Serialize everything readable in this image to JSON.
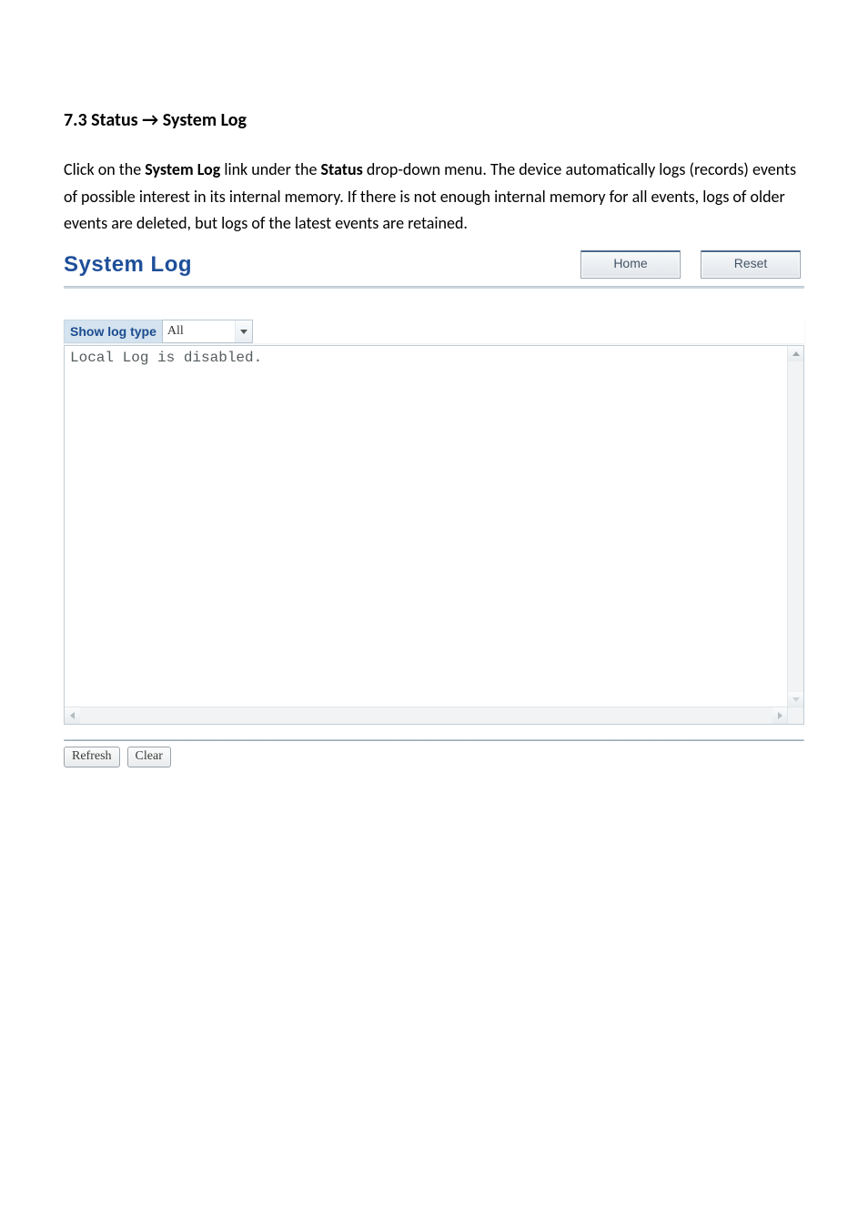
{
  "section": {
    "heading": "7.3 Status → System Log",
    "paragraph_parts": {
      "p1": "Click on the ",
      "b1": "System Log",
      "p2": " link under the ",
      "b2": "Status",
      "p3": " drop-down menu. The device automatically logs (records) events of possible interest in its internal memory. If there is not enough internal memory for all events, logs of older events are deleted, but logs of the latest events are retained."
    }
  },
  "ui": {
    "title": "System Log",
    "buttons": {
      "home": "Home",
      "reset": "Reset"
    },
    "filter": {
      "label": "Show log type",
      "selected": "All"
    },
    "log_text": "Local Log is disabled.",
    "footer": {
      "refresh": "Refresh",
      "clear": "Clear"
    }
  }
}
